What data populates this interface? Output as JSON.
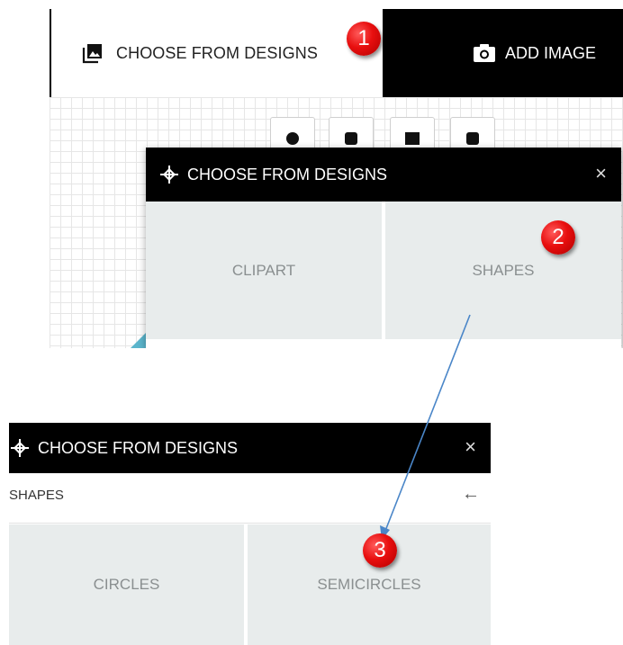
{
  "top": {
    "tabs": [
      {
        "label": "CHOOSE FROM DESIGNS",
        "icon": "images-icon"
      },
      {
        "label": "ADD IMAGE",
        "icon": "camera-icon"
      }
    ],
    "toolbar_icons": [
      "download-icon",
      "print-icon",
      "magnet-icon",
      "zoom-icon"
    ],
    "modal": {
      "title": "CHOOSE FROM DESIGNS",
      "close": "×",
      "options": [
        "CLIPART",
        "SHAPES"
      ]
    }
  },
  "bottom": {
    "modal": {
      "title": "CHOOSE FROM DESIGNS",
      "close": "×",
      "subtitle": "SHAPES",
      "back": "←",
      "options": [
        "CIRCLES",
        "SEMICIRCLES"
      ]
    }
  },
  "callouts": [
    "1",
    "2",
    "3"
  ],
  "colors": {
    "header_bg": "#000000",
    "tile_bg": "#e8ecec",
    "badge_red": "#e80f0f",
    "arrow_blue": "#4a86c8",
    "teal_accent": "#5bb5cc"
  }
}
